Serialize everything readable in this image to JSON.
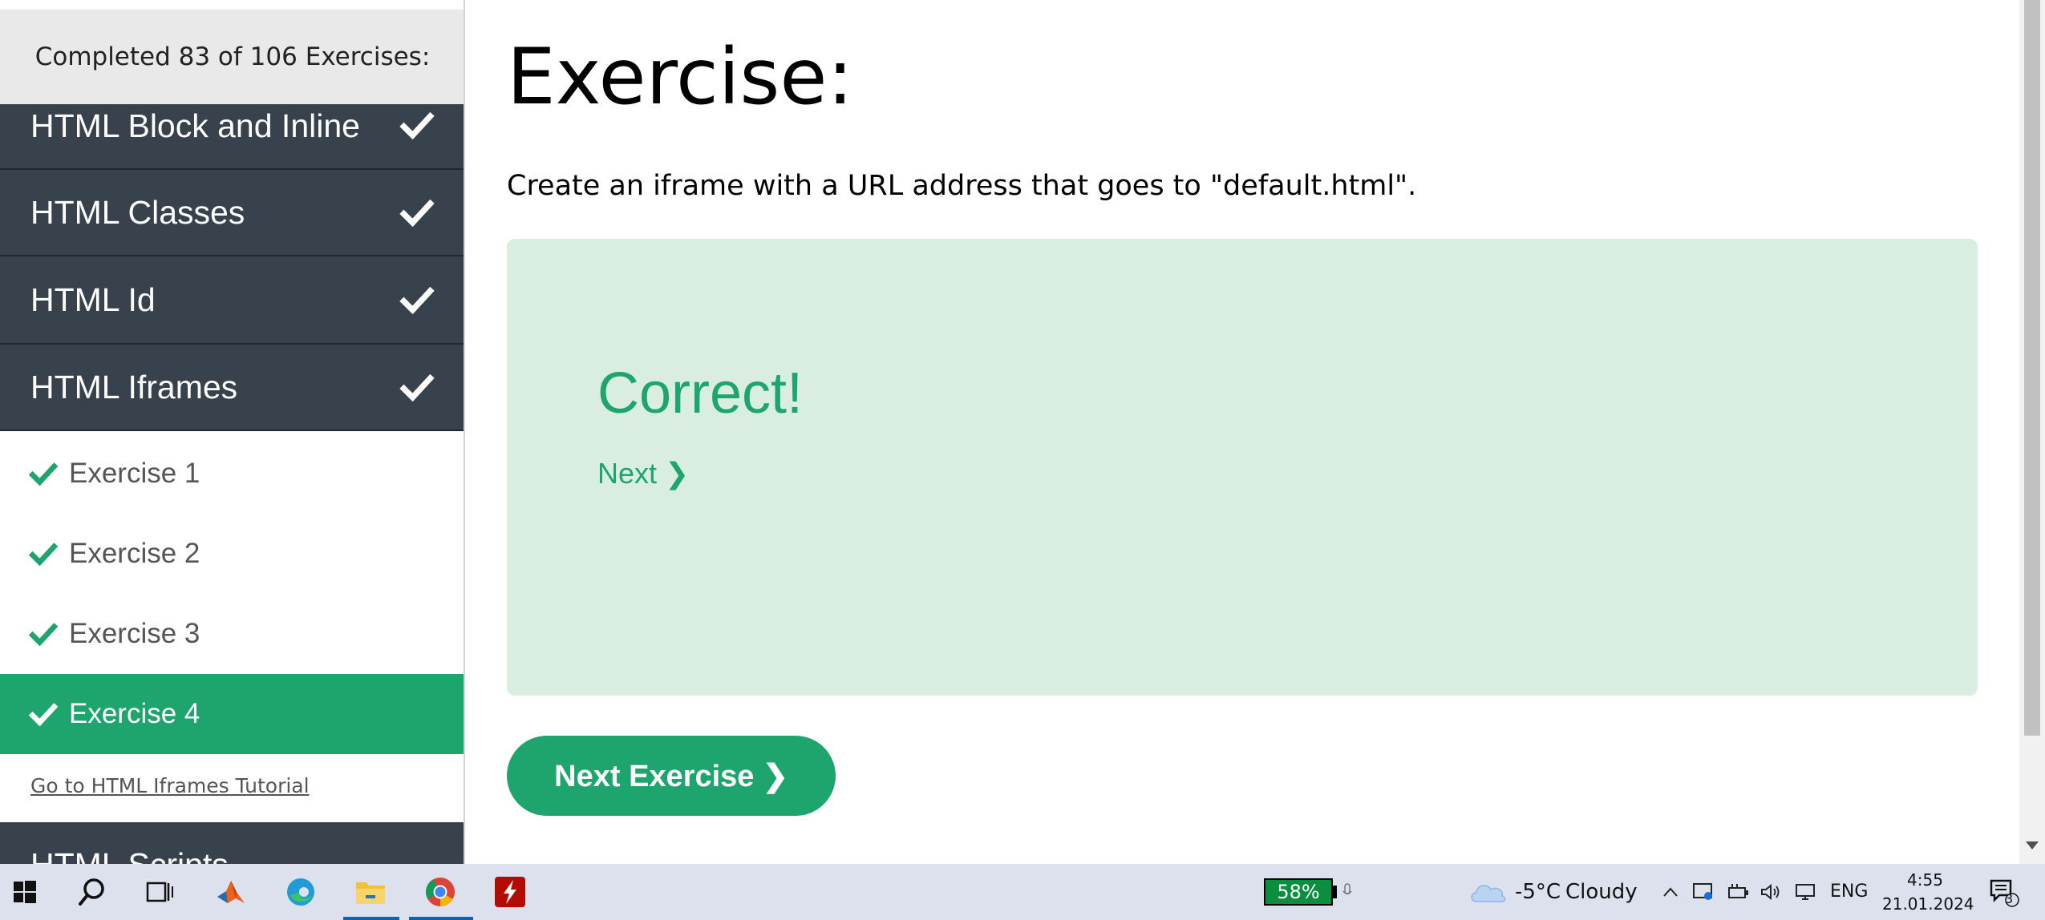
{
  "sidebar": {
    "progress_text": "Completed 83 of 106 Exercises:",
    "chapters": [
      {
        "label": "HTML Block and Inline",
        "completed": true
      },
      {
        "label": "HTML Classes",
        "completed": true
      },
      {
        "label": "HTML Id",
        "completed": true
      },
      {
        "label": "HTML Iframes",
        "completed": true
      }
    ],
    "exercises": [
      {
        "label": "Exercise 1",
        "completed": true,
        "active": false
      },
      {
        "label": "Exercise 2",
        "completed": true,
        "active": false
      },
      {
        "label": "Exercise 3",
        "completed": true,
        "active": false
      },
      {
        "label": "Exercise 4",
        "completed": true,
        "active": true
      }
    ],
    "tutorial_link": "Go to HTML Iframes Tutorial",
    "next_chapter": "HTML Scripts"
  },
  "main": {
    "title": "Exercise:",
    "description": "Create an iframe with a URL address that goes to \"default.html\".",
    "result": {
      "heading": "Correct!",
      "next_link": "Next ❯"
    },
    "next_button": "Next Exercise ❯"
  },
  "taskbar": {
    "battery_percent": "58%",
    "weather_temp": "-5°C",
    "weather_desc": "Cloudy",
    "language": "ENG",
    "time": "4:55",
    "date": "21.01.2024",
    "notification_count": "3"
  },
  "colors": {
    "accent_green": "#1ea56d",
    "sidebar_dark": "#38424c",
    "result_bg": "#d9ede1"
  }
}
